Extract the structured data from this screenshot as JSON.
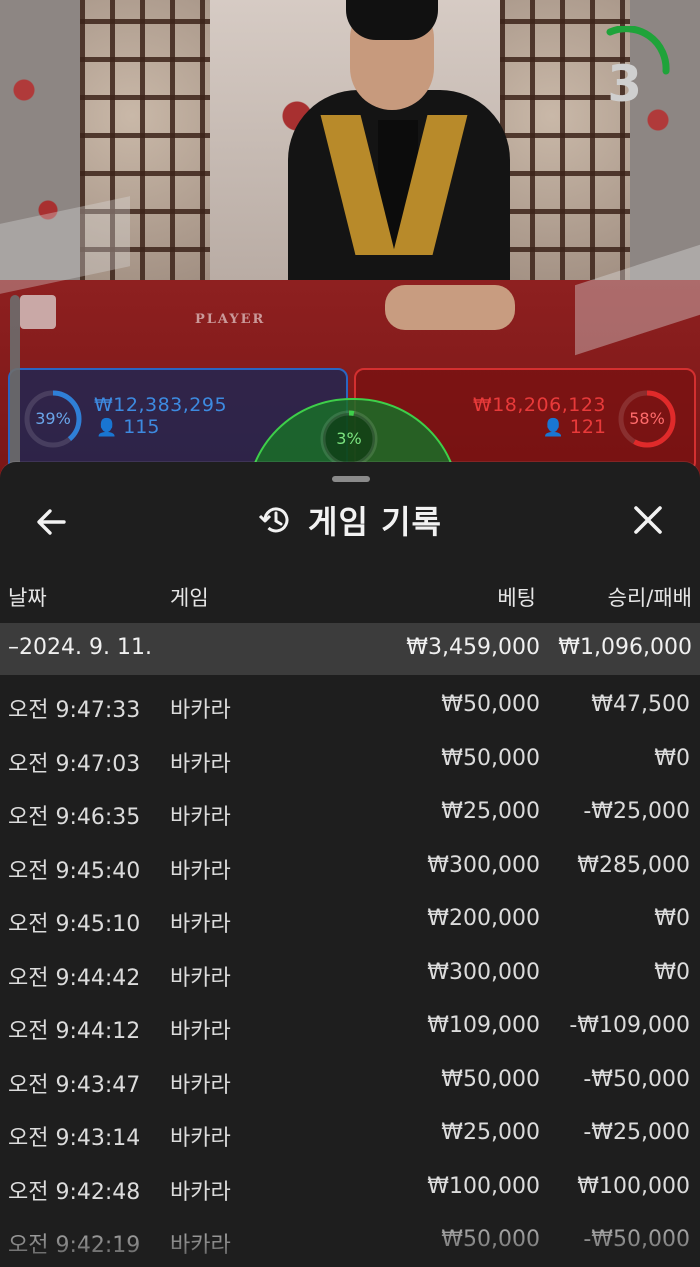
{
  "stream": {
    "countdown": "3",
    "table_label": "PLAYER"
  },
  "bets": {
    "player": {
      "percent": "39%",
      "amount": "₩12,383,295",
      "players": "115",
      "color": "#2f7fd6"
    },
    "tie": {
      "percent": "3%",
      "color": "#3ecf4a"
    },
    "banker": {
      "percent": "58%",
      "amount": "₩18,206,123",
      "players": "121",
      "color": "#e02a2a"
    }
  },
  "sheet": {
    "title": "게임 기록",
    "back_icon": "arrow-left-icon",
    "history_icon": "history-icon",
    "close_icon": "close-icon",
    "columns": {
      "date": "날짜",
      "game": "게임",
      "bet": "베팅",
      "result": "승리/패배"
    },
    "group": {
      "date": "–2024. 9. 11.",
      "bet_total": "₩3,459,000",
      "result_total": "₩1,096,000"
    },
    "rows": [
      {
        "time": "오전 9:47:33",
        "game": "바카라",
        "bet": "₩50,000",
        "result": "₩47,500"
      },
      {
        "time": "오전 9:47:03",
        "game": "바카라",
        "bet": "₩50,000",
        "result": "₩0"
      },
      {
        "time": "오전 9:46:35",
        "game": "바카라",
        "bet": "₩25,000",
        "result": "-₩25,000"
      },
      {
        "time": "오전 9:45:40",
        "game": "바카라",
        "bet": "₩300,000",
        "result": "₩285,000"
      },
      {
        "time": "오전 9:45:10",
        "game": "바카라",
        "bet": "₩200,000",
        "result": "₩0"
      },
      {
        "time": "오전 9:44:42",
        "game": "바카라",
        "bet": "₩300,000",
        "result": "₩0"
      },
      {
        "time": "오전 9:44:12",
        "game": "바카라",
        "bet": "₩109,000",
        "result": "-₩109,000"
      },
      {
        "time": "오전 9:43:47",
        "game": "바카라",
        "bet": "₩50,000",
        "result": "-₩50,000"
      },
      {
        "time": "오전 9:43:14",
        "game": "바카라",
        "bet": "₩25,000",
        "result": "-₩25,000"
      },
      {
        "time": "오전 9:42:48",
        "game": "바카라",
        "bet": "₩100,000",
        "result": "₩100,000"
      },
      {
        "time": "오전 9:42:19",
        "game": "바카라",
        "bet": "₩50,000",
        "result": "-₩50,000"
      }
    ]
  }
}
